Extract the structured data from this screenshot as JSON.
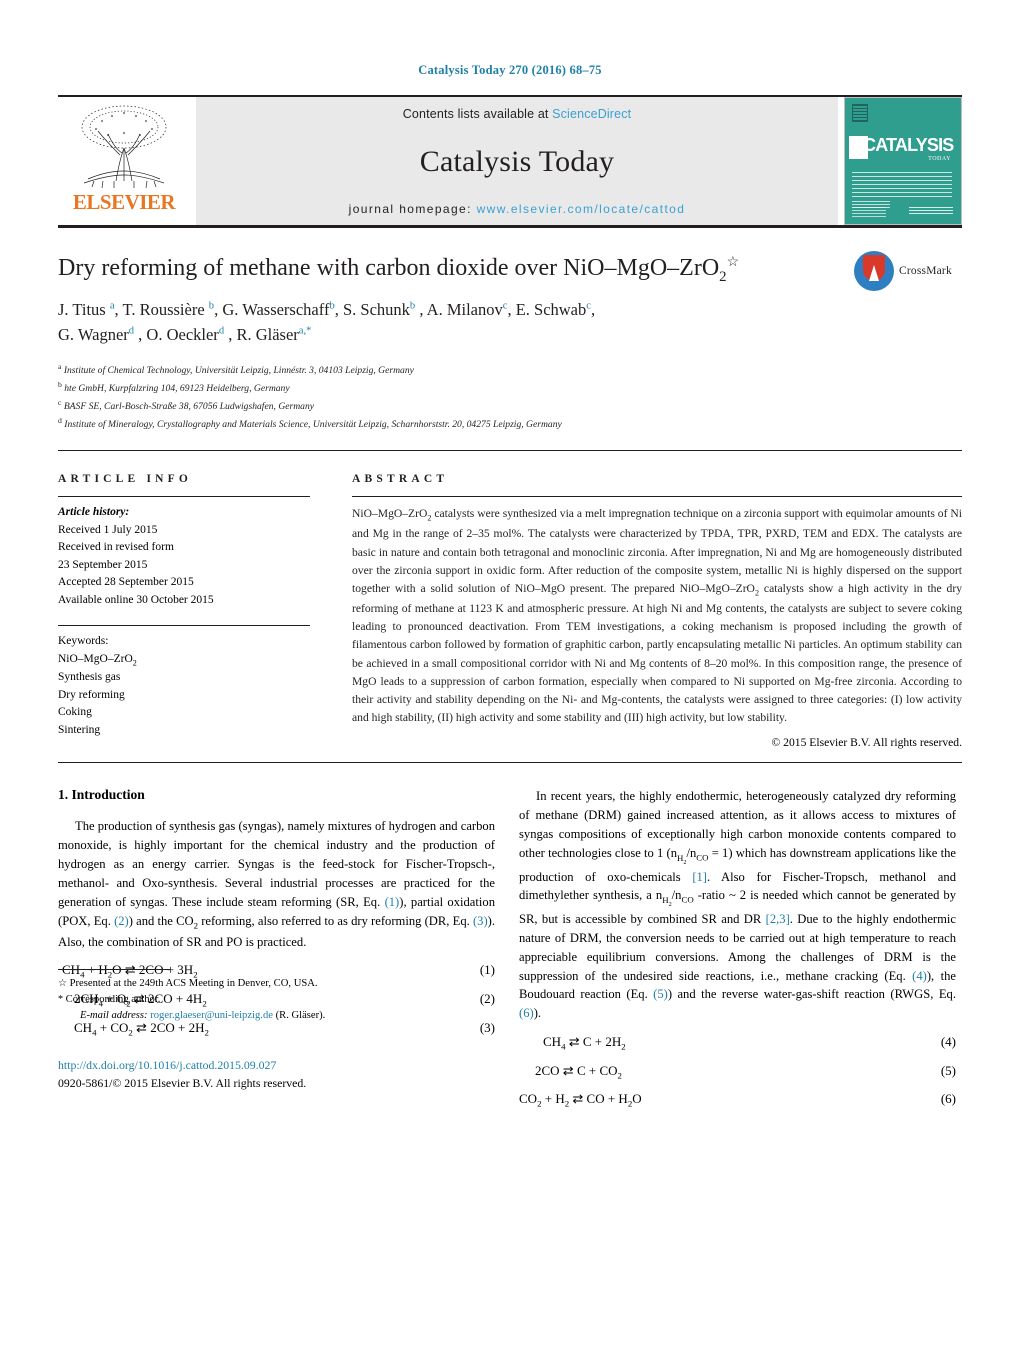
{
  "running_head": "Catalysis Today 270 (2016) 68–75",
  "masthead": {
    "publisher": "ELSEVIER",
    "contents_prefix": "Contents lists available at ",
    "sciencedirect": "ScienceDirect",
    "journal_title": "Catalysis Today",
    "homepage_prefix": "journal homepage: ",
    "homepage_url": "www.elsevier.com/locate/cattod",
    "cover_title": "CATALYSIS",
    "cover_subtitle": "TODAY",
    "cover_footer": "ScienceDirect",
    "colors": {
      "elsevier_orange": "#e77724",
      "link_blue": "#3aa0d1",
      "cover_teal": "#2f9e8f"
    }
  },
  "article": {
    "title_main": "Dry reforming of methane with carbon dioxide over NiO–MgO–ZrO",
    "title_sub": "2",
    "title_footnote_mark": "☆",
    "crossmark_label": "CrossMark",
    "authors_line1": "J. Titus a, T. Roussière b, G. Wasserschaff b, S. Schunk b, A. Milanov c, E. Schwab c,",
    "authors_line2": "G. Wagner d, O. Oeckler d, R. Gläser a,*",
    "authors": [
      {
        "name": "J. Titus",
        "marks": "a"
      },
      {
        "name": "T. Roussière",
        "marks": "b"
      },
      {
        "name": "G. Wasserschaff",
        "marks": "b"
      },
      {
        "name": "S. Schunk",
        "marks": "b"
      },
      {
        "name": "A. Milanov",
        "marks": "c"
      },
      {
        "name": "E. Schwab",
        "marks": "c"
      },
      {
        "name": "G. Wagner",
        "marks": "d"
      },
      {
        "name": "O. Oeckler",
        "marks": "d"
      },
      {
        "name": "R. Gläser",
        "marks": "a,*"
      }
    ],
    "affiliations": [
      {
        "mark": "a",
        "text": "Institute of Chemical Technology, Universität Leipzig, Linnéstr. 3, 04103 Leipzig, Germany"
      },
      {
        "mark": "b",
        "text": "hte GmbH, Kurpfalzring 104, 69123 Heidelberg, Germany"
      },
      {
        "mark": "c",
        "text": "BASF SE, Carl-Bosch-Straße 38, 67056 Ludwigshafen, Germany"
      },
      {
        "mark": "d",
        "text": "Institute of Mineralogy, Crystallography and Materials Science, Universität Leipzig, Scharnhorststr. 20, 04275 Leipzig, Germany"
      }
    ]
  },
  "article_info": {
    "heading": "ARTICLE INFO",
    "history_label": "Article history:",
    "history": [
      "Received 1 July 2015",
      "Received in revised form",
      "23 September 2015",
      "Accepted 28 September 2015",
      "Available online 30 October 2015"
    ],
    "keywords_label": "Keywords:",
    "keywords": [
      "NiO–MgO–ZrO2",
      "Synthesis gas",
      "Dry reforming",
      "Coking",
      "Sintering"
    ]
  },
  "abstract": {
    "heading": "ABSTRACT",
    "text": "NiO–MgO–ZrO2 catalysts were synthesized via a melt impregnation technique on a zirconia support with equimolar amounts of Ni and Mg in the range of 2–35 mol%. The catalysts were characterized by TPDA, TPR, PXRD, TEM and EDX. The catalysts are basic in nature and contain both tetragonal and monoclinic zirconia. After impregnation, Ni and Mg are homogeneously distributed over the zirconia support in oxidic form. After reduction of the composite system, metallic Ni is highly dispersed on the support together with a solid solution of NiO–MgO present. The prepared NiO–MgO–ZrO2 catalysts show a high activity in the dry reforming of methane at 1123 K and atmospheric pressure. At high Ni and Mg contents, the catalysts are subject to severe coking leading to pronounced deactivation. From TEM investigations, a coking mechanism is proposed including the growth of filamentous carbon followed by formation of graphitic carbon, partly encapsulating metallic Ni particles. An optimum stability can be achieved in a small compositional corridor with Ni and Mg contents of 8–20 mol%. In this composition range, the presence of MgO leads to a suppression of carbon formation, especially when compared to Ni supported on Mg-free zirconia. According to their activity and stability depending on the Ni- and Mg-contents, the catalysts were assigned to three categories: (I) low activity and high stability, (II) high activity and some stability and (III) high activity, but low stability.",
    "copyright": "© 2015 Elsevier B.V. All rights reserved."
  },
  "body": {
    "section_number_title": "1.  Introduction",
    "left_para_1": "The production of synthesis gas (syngas), namely mixtures of hydrogen and carbon monoxide, is highly important for the chemical industry and the production of hydrogen as an energy carrier. Syngas is the feed-stock for Fischer-Tropsch-, methanol- and Oxo-synthesis. Several industrial processes are practiced for the generation of syngas. These include steam reforming (SR, Eq. (1)), partial oxidation (POX, Eq. (2)) and the CO2 reforming, also referred to as dry reforming (DR, Eq. (3)). Also, the combination of SR and PO is practiced.",
    "right_para_1": "In recent years, the highly endothermic, heterogeneously catalyzed dry reforming of methane (DRM) gained increased attention, as it allows access to mixtures of syngas compositions of exceptionally high carbon monoxide contents compared to other technologies close to 1 (nH2/nCO = 1) which has downstream applications like the production of oxo-chemicals [1]. Also for Fischer-Tropsch, methanol and dimethylether synthesis, a nH2/nCO -ratio ~ 2 is needed which cannot be generated by SR, but is accessible by combined SR and DR [2,3]. Due to the highly endothermic nature of DRM, the conversion needs to be carried out at high temperature to reach appreciable equilibrium conversions. Among the challenges of DRM is the suppression of the undesired side reactions, i.e., methane cracking (Eq. (4)), the Boudouard reaction (Eq. (5)) and the reverse water-gas-shift reaction (RWGS, Eq. (6))."
  },
  "equations": [
    {
      "number": "(1)",
      "text": "CH4 + H2O ⇄ 2CO + 3H2"
    },
    {
      "number": "(2)",
      "text": "2CH4 + O2 ⇄ 2CO + 4H2"
    },
    {
      "number": "(3)",
      "text": "CH4 + CO2 ⇄ 2CO + 2H2"
    },
    {
      "number": "(4)",
      "text": "CH4 ⇄ C + 2H2"
    },
    {
      "number": "(5)",
      "text": "2CO ⇄ C + CO2"
    },
    {
      "number": "(6)",
      "text": "CO2 + H2 ⇄ CO + H2O"
    }
  ],
  "footnotes": {
    "star_mark": "☆",
    "star_text": "Presented at the 249th ACS Meeting in Denver, CO, USA.",
    "corr_mark": "*",
    "corr_text": "Corresponding author.",
    "email_label": "E-mail address:",
    "email": "roger.glaeser@uni-leipzig.de",
    "email_person": "(R. Gläser).",
    "doi": "http://dx.doi.org/10.1016/j.cattod.2015.09.027",
    "issn": "0920-5861/© 2015 Elsevier B.V. All rights reserved."
  }
}
